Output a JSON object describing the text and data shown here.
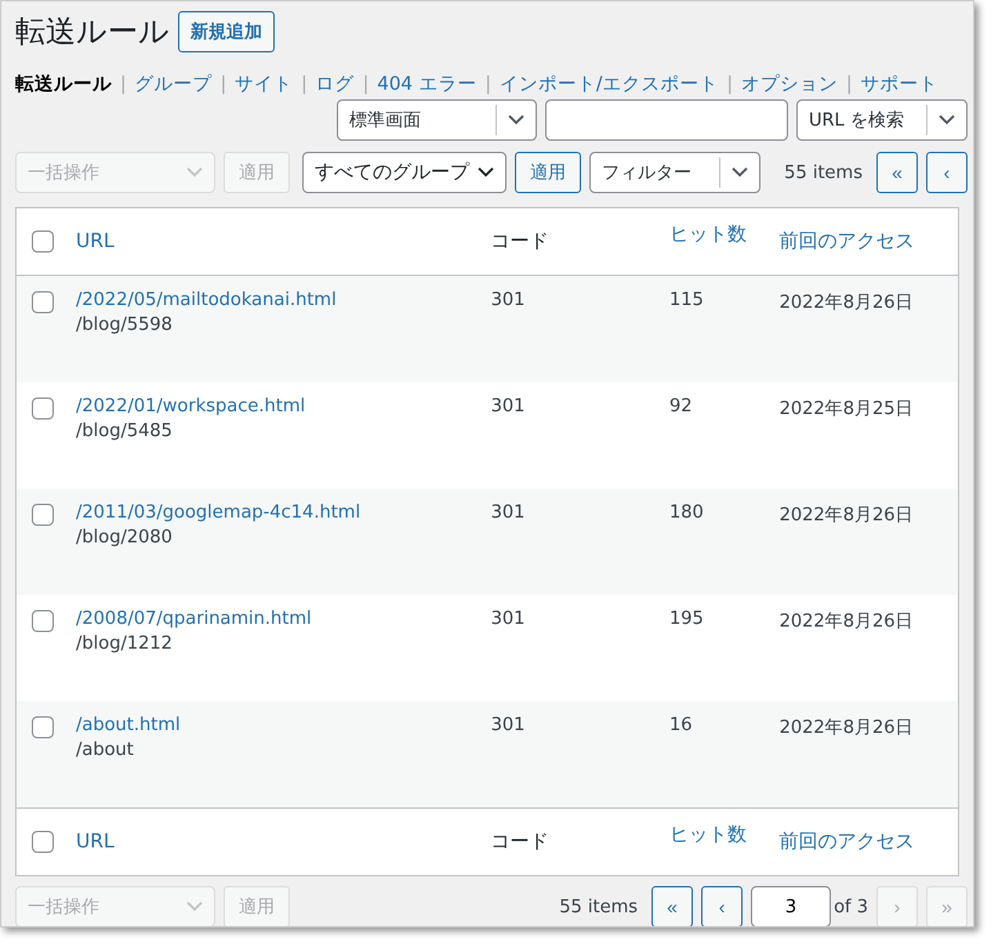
{
  "title": "転送ルール",
  "add_button": "新規追加",
  "nav": [
    {
      "label": "転送ルール",
      "selected": true
    },
    {
      "separator": "|",
      "label": "グループ",
      "selected": false
    },
    {
      "separator": "|",
      "label": "サイト",
      "selected": false
    },
    {
      "separator": "|",
      "label": "ログ",
      "selected": false
    },
    {
      "separator": "|",
      "label": "404 エラー",
      "selected": false
    },
    {
      "separator": "|",
      "label": "インポート/エクスポート",
      "selected": false
    },
    {
      "separator": "|",
      "label": "オプション",
      "selected": false
    },
    {
      "separator": "|",
      "label": "サポート",
      "selected": false
    }
  ],
  "search": {
    "view_select": "標準画面",
    "search_button": "URL を検索"
  },
  "top_nav": {
    "bulk_action": {
      "label": "一括操作",
      "disabled": true
    },
    "bulk_apply": {
      "label": "適用",
      "disabled": true
    },
    "group_select": "すべてのグループ",
    "group_apply": "適用",
    "filter": "フィルター",
    "items_count": "55 items",
    "pagination": [
      {
        "label": "«",
        "disabled": false
      },
      {
        "label": "‹",
        "disabled": false
      }
    ]
  },
  "header_checked": false,
  "footer_checked": false,
  "columns": [
    {
      "label": "URL",
      "sortable": true
    },
    {
      "label": "コード",
      "sortable": false
    },
    {
      "label": "ヒット数",
      "sortable": true
    },
    {
      "label": "前回のアクセス",
      "sortable": true
    }
  ],
  "rows": [
    {
      "checked": false,
      "url": "/2022/05/mailtodokanai.html",
      "target": "/blog/5598",
      "code": "301",
      "hits": "115",
      "last_access": "2022年8月26日"
    },
    {
      "checked": false,
      "url": "/2022/01/workspace.html",
      "target": "/blog/5485",
      "code": "301",
      "hits": "92",
      "last_access": "2022年8月25日"
    },
    {
      "checked": false,
      "url": "/2011/03/googlemap-4c14.html",
      "target": "/blog/2080",
      "code": "301",
      "hits": "180",
      "last_access": "2022年8月26日"
    },
    {
      "checked": false,
      "url": "/2008/07/qparinamin.html",
      "target": "/blog/1212",
      "code": "301",
      "hits": "195",
      "last_access": "2022年8月26日"
    },
    {
      "checked": false,
      "url": "/about.html",
      "target": "/about",
      "code": "301",
      "hits": "16",
      "last_access": "2022年8月26日"
    }
  ],
  "footer_columns": [
    {
      "label": "URL",
      "sortable": true
    },
    {
      "label": "コード",
      "sortable": false
    },
    {
      "label": "ヒット数",
      "sortable": true
    },
    {
      "label": "前回のアクセス",
      "sortable": true
    }
  ],
  "bottom_nav": {
    "bulk_action": {
      "label": "一括操作",
      "disabled": true
    },
    "bulk_apply": {
      "label": "適用",
      "disabled": true
    },
    "items_count": "55 items",
    "pagination_before": [
      {
        "label": "«",
        "disabled": false
      },
      {
        "label": "‹",
        "disabled": false
      }
    ],
    "page": "3",
    "of": "of 3",
    "pagination_after": [
      {
        "label": "›",
        "disabled": true
      },
      {
        "label": "»",
        "disabled": true
      }
    ]
  }
}
